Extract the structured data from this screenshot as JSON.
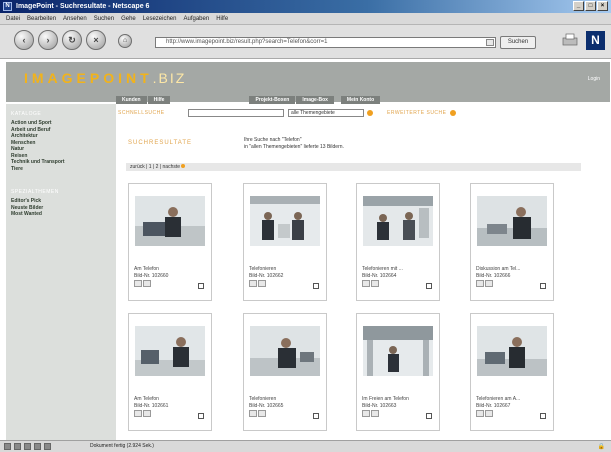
{
  "window": {
    "title": "ImagePoint - Suchresultate - Netscape 6",
    "icon": "N",
    "buttons": [
      "_",
      "□",
      "×"
    ]
  },
  "menu": [
    "Datei",
    "Bearbeiten",
    "Ansehen",
    "Suchen",
    "Gehe",
    "Lesezeichen",
    "Aufgaben",
    "Hilfe"
  ],
  "toolbar": {
    "url": "http://www.imagepoint.biz/result.php?search=Telefon&corr=1",
    "search_label": "Suchen",
    "netscape_logo": "N"
  },
  "site": {
    "logo_main": "IMAGEPOINT",
    "logo_suffix": ".BIZ",
    "login": "Login",
    "topnav": [
      "Kunden",
      "Hilfe",
      "Projekt-Boxen",
      "Image-Box",
      "Mein Konto"
    ]
  },
  "sidebar": {
    "catalog_heading": "KATALOGE",
    "catalog_items": [
      "Action und Sport",
      "Arbeit und Beruf",
      "Architektur",
      "Menschen",
      "Natur",
      "Reisen",
      "Technik und Transport",
      "Tiere"
    ],
    "special_heading": "SPEZIALTHEMEN",
    "special_items": [
      "Editor's Pick",
      "Neuste Bilder",
      "Most Wanted"
    ]
  },
  "search": {
    "quick_label": "SCHNELLSUCHE",
    "quick_value": "",
    "category_select": "alle Themengebiete",
    "advanced_link": "ERWEITERTE SUCHE"
  },
  "results": {
    "title": "SUCHRESULTATE",
    "info_line1": "Ihre Suche nach \"Telefon\"",
    "info_line2": "in \"allen Themengebieten\" lieferte 13 Bildern.",
    "pager": "zurück | 1 | 2 | nachste"
  },
  "cards": [
    {
      "title": "Am Telefon",
      "id": "Bild-Nr. 102660"
    },
    {
      "title": "Telefonieren",
      "id": "Bild-Nr. 102662"
    },
    {
      "title": "Telefonieren mit ...",
      "id": "Bild-Nr. 102664"
    },
    {
      "title": "Diskussion am Tel...",
      "id": "Bild-Nr. 102666"
    },
    {
      "title": "Am Telefon",
      "id": "Bild-Nr. 102661"
    },
    {
      "title": "Telefonieren",
      "id": "Bild-Nr. 102665"
    },
    {
      "title": "Im Freien am Telefon",
      "id": "Bild-Nr. 102663"
    },
    {
      "title": "Telefonieren am A...",
      "id": "Bild-Nr. 102667"
    }
  ],
  "status": {
    "text": "Dokument fertig (2.924 Sek.)"
  },
  "colors": {
    "accent": "#f2b31a",
    "header_bg": "#a4a8a5",
    "sidebar_bg": "#dcdfdc"
  }
}
